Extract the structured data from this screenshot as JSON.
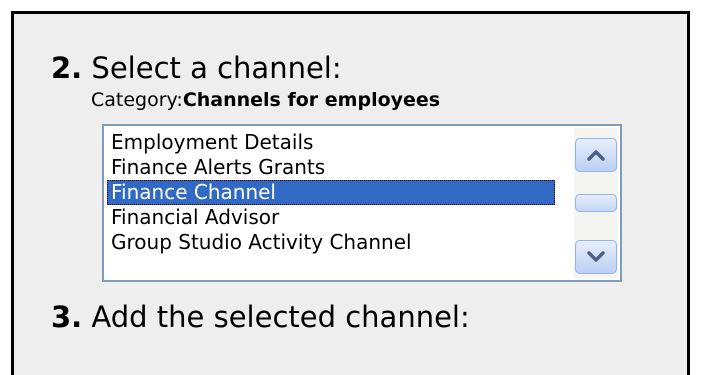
{
  "step2": {
    "number": "2.",
    "label": " Select a channel:"
  },
  "category": {
    "label": "Category:",
    "value": "Channels for employees"
  },
  "channel_list": {
    "items": [
      "Employment Details",
      "Finance Alerts Grants",
      "Finance Channel",
      "Financial Advisor",
      "Group Studio Activity Channel"
    ],
    "selected": "Finance Channel"
  },
  "scrollbar": {
    "up_icon": "chevron-up-icon",
    "down_icon": "chevron-down-icon"
  },
  "step3": {
    "number": "3.",
    "label": " Add the selected channel:"
  },
  "colors": {
    "selection": "#316ac5",
    "list_border": "#7f9db9",
    "panel_bg": "#eeeeee",
    "arrow": "#4d6185"
  }
}
